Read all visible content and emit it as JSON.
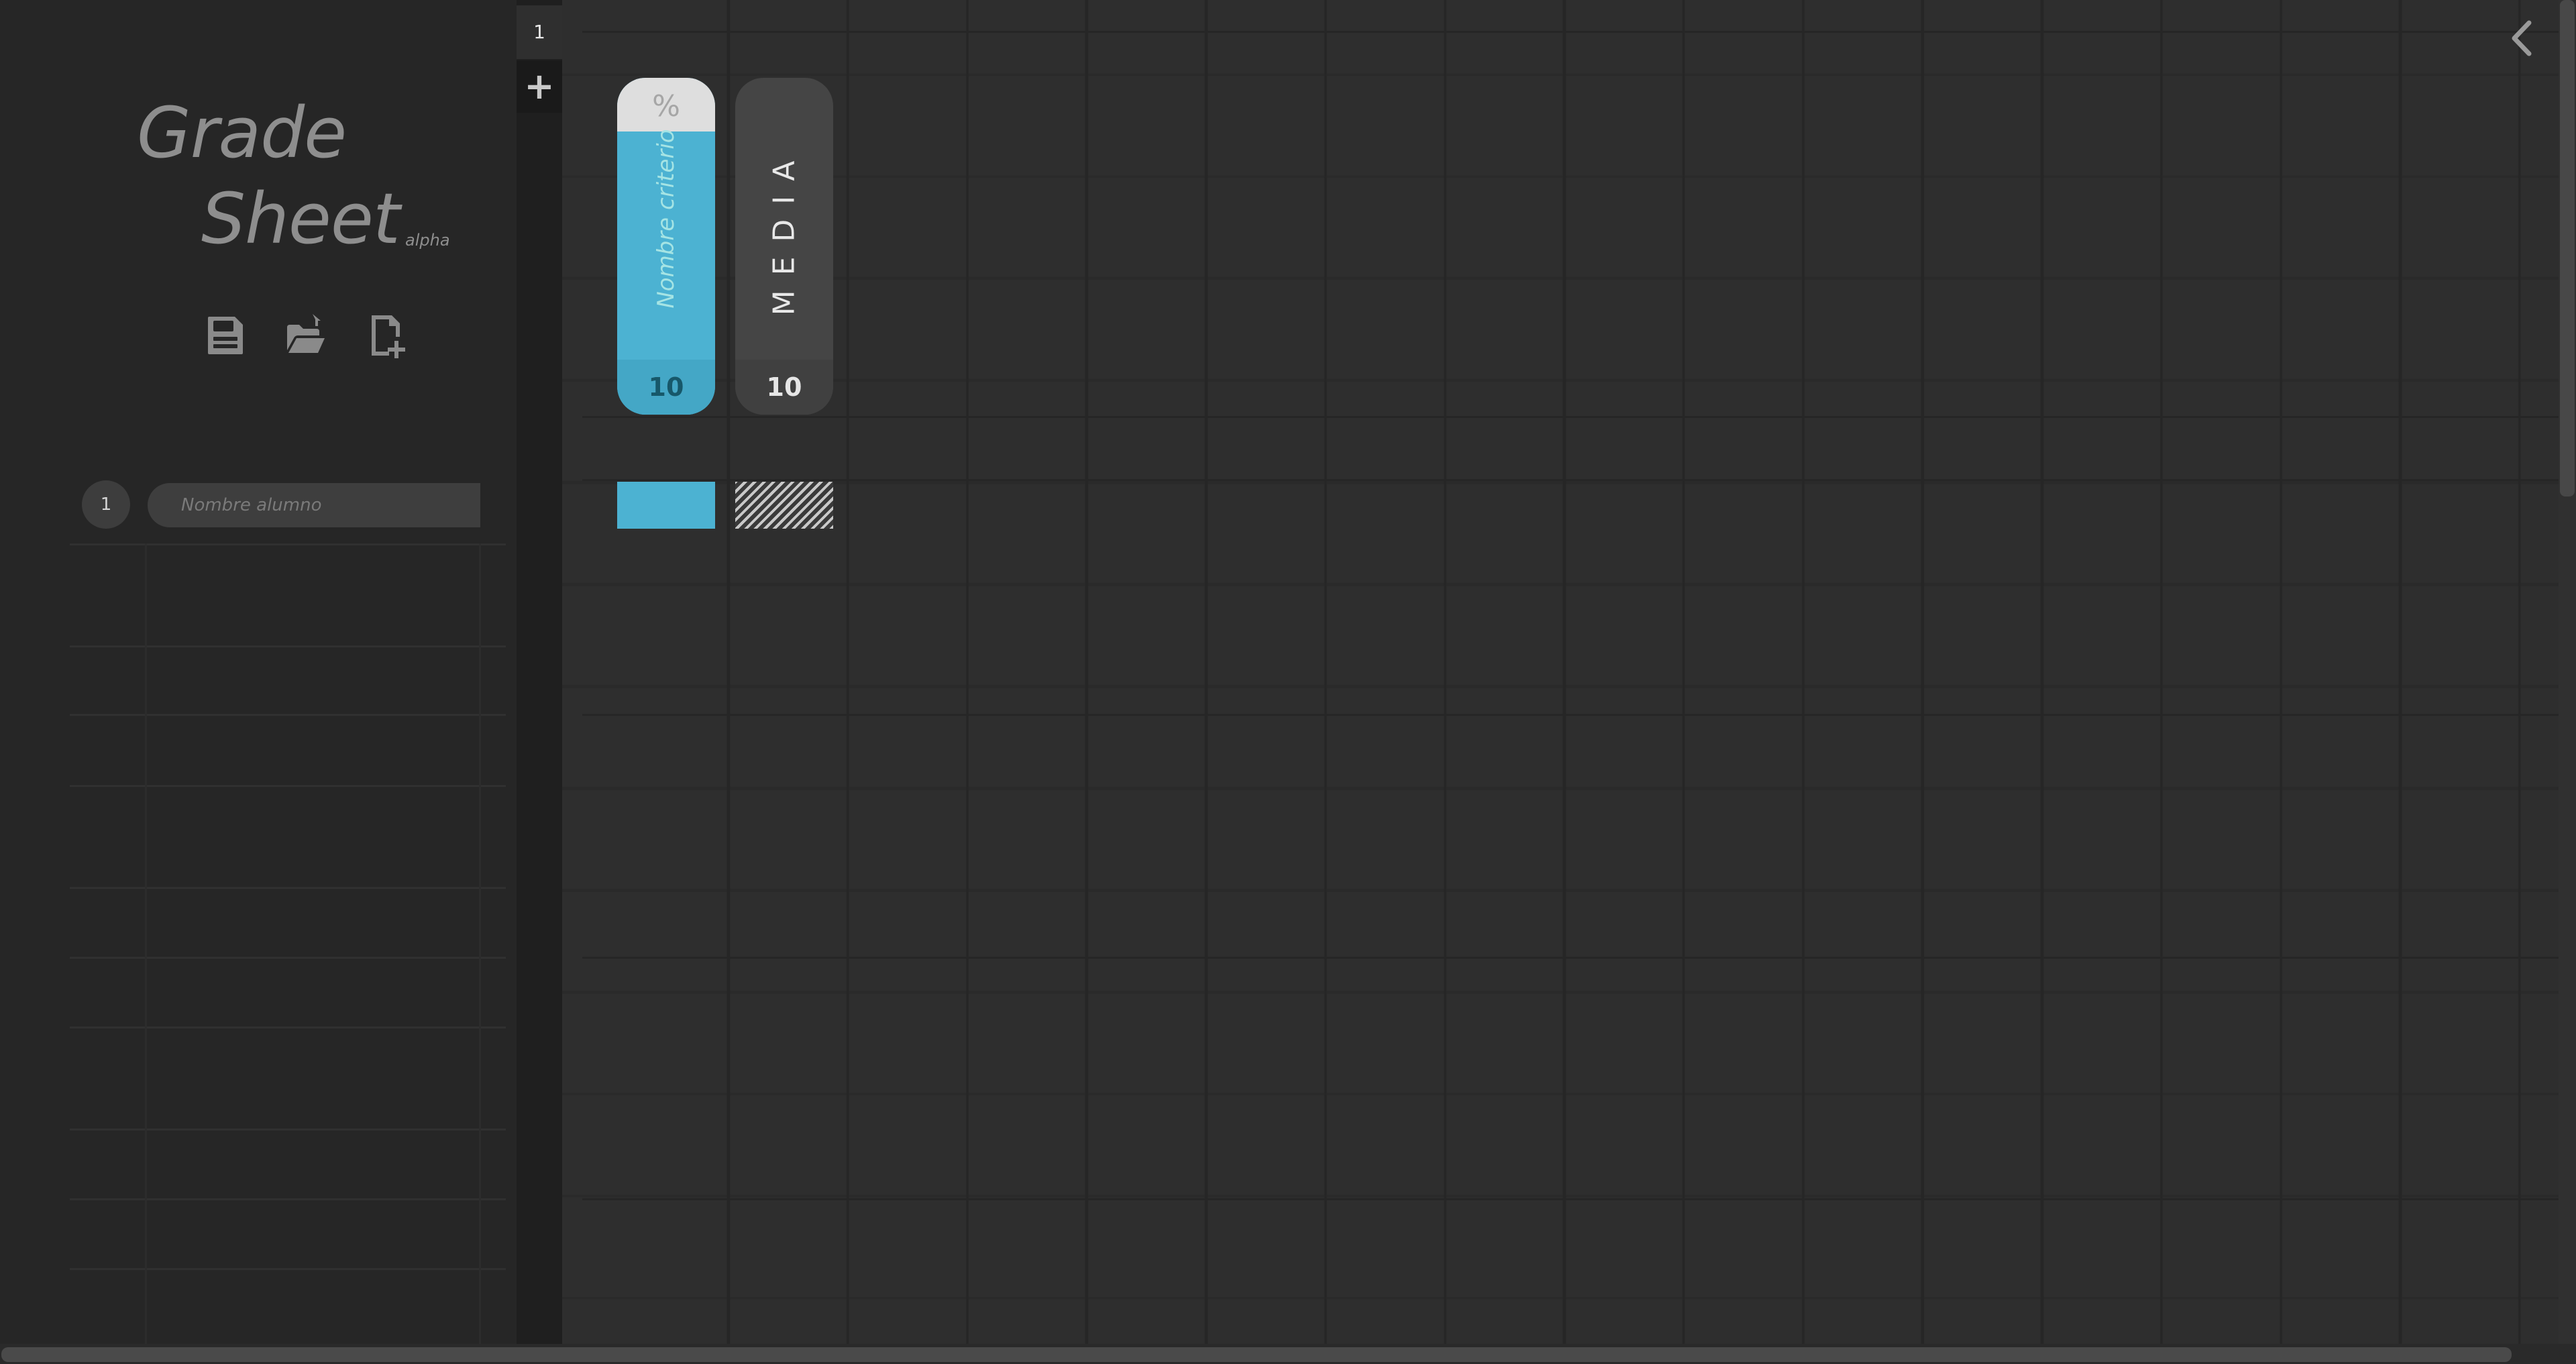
{
  "app": {
    "logo_line1": "Grade",
    "logo_line2": "Sheet",
    "logo_tag": "alpha"
  },
  "toolbar": {
    "save_icon": "save-icon",
    "open_icon": "folder-open-icon",
    "new_icon": "new-document-icon"
  },
  "tabs": {
    "items": [
      {
        "label": "1"
      }
    ],
    "add_label": "+"
  },
  "criterion": {
    "percent_symbol": "%",
    "name_placeholder": "Nombre criterio",
    "max_grade": "10",
    "color": "#4cb2d2"
  },
  "media": {
    "label": "MEDIA",
    "max_grade": "10"
  },
  "students": [
    {
      "number": "1",
      "placeholder": "Nombre alumno"
    }
  ],
  "theme": {
    "background": "#2d2d2d",
    "sidebar": "#262626",
    "accent": "#4cb2d2"
  }
}
